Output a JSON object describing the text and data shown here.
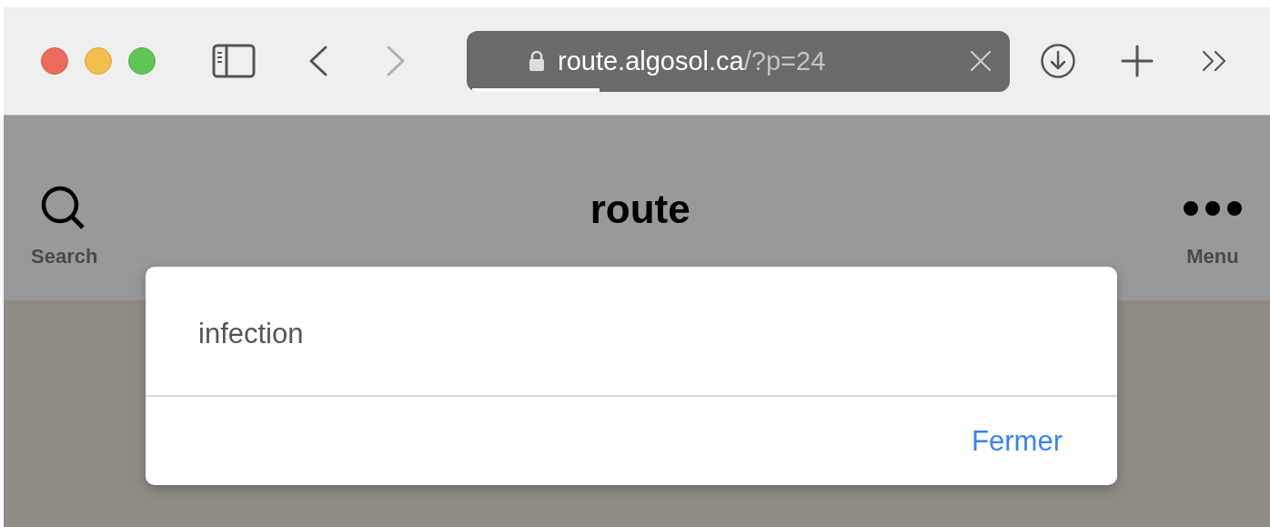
{
  "browser": {
    "url": {
      "host": "route.algosol.ca",
      "path": "/?p=24"
    },
    "load_progress": {
      "level": 0.24
    }
  },
  "header": {
    "search_label": "Search",
    "site_title": "route",
    "menu_label": "Menu"
  },
  "dialog": {
    "message": "infection",
    "button": "Fermer"
  }
}
